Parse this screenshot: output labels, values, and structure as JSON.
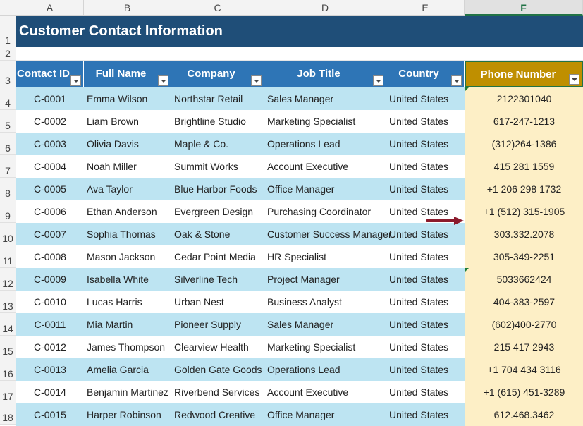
{
  "columns": [
    "A",
    "B",
    "C",
    "D",
    "E",
    "F"
  ],
  "row_numbers": [
    "1",
    "2",
    "3",
    "4",
    "5",
    "6",
    "7",
    "8",
    "9",
    "10",
    "11",
    "12",
    "13",
    "14",
    "15",
    "16",
    "17",
    "18"
  ],
  "title": "Customer Contact Information",
  "headers": [
    "Contact ID",
    "Full Name",
    "Company",
    "Job Title",
    "Country",
    "Phone Number"
  ],
  "rows": [
    [
      "C-0001",
      "Emma Wilson",
      "Northstar Retail",
      "Sales Manager",
      "United States",
      "2122301040"
    ],
    [
      "C-0002",
      "Liam Brown",
      "Brightline Studio",
      "Marketing Specialist",
      "United States",
      "617-247-1213"
    ],
    [
      "C-0003",
      "Olivia Davis",
      "Maple & Co.",
      "Operations Lead",
      "United States",
      "(312)264-1386"
    ],
    [
      "C-0004",
      "Noah Miller",
      "Summit Works",
      "Account Executive",
      "United States",
      "415 281 1559"
    ],
    [
      "C-0005",
      "Ava Taylor",
      "Blue Harbor Foods",
      "Office Manager",
      "United States",
      "+1 206 298 1732"
    ],
    [
      "C-0006",
      "Ethan Anderson",
      "Evergreen Design",
      "Purchasing Coordinator",
      "United States",
      "+1 (512) 315-1905"
    ],
    [
      "C-0007",
      "Sophia Thomas",
      "Oak & Stone",
      "Customer Success Manager",
      "United States",
      "303.332.2078"
    ],
    [
      "C-0008",
      "Mason Jackson",
      "Cedar Point Media",
      "HR Specialist",
      "United States",
      "305-349-2251"
    ],
    [
      "C-0009",
      "Isabella White",
      "Silverline Tech",
      "Project Manager",
      "United States",
      "5033662424"
    ],
    [
      "C-0010",
      "Lucas Harris",
      "Urban Nest",
      "Business Analyst",
      "United States",
      "404-383-2597"
    ],
    [
      "C-0011",
      "Mia Martin",
      "Pioneer Supply",
      "Sales Manager",
      "United States",
      "(602)400-2770"
    ],
    [
      "C-0012",
      "James Thompson",
      "Clearview Health",
      "Marketing Specialist",
      "United States",
      "215 417 2943"
    ],
    [
      "C-0013",
      "Amelia Garcia",
      "Golden Gate Goods",
      "Operations Lead",
      "United States",
      "+1 704 434 3116"
    ],
    [
      "C-0014",
      "Benjamin Martinez",
      "Riverbend Services",
      "Account Executive",
      "United States",
      "+1 (615) 451-3289"
    ],
    [
      "C-0015",
      "Harper Robinson",
      "Redwood Creative",
      "Office Manager",
      "United States",
      "612.468.3462"
    ]
  ],
  "colors": {
    "title_band": "#1f4e78",
    "header": "#2e75b6",
    "phone_header": "#bf8f00",
    "band_row": "#bde4f2",
    "phone_fill": "#fdefc6",
    "arrow": "#8b1a2c"
  }
}
